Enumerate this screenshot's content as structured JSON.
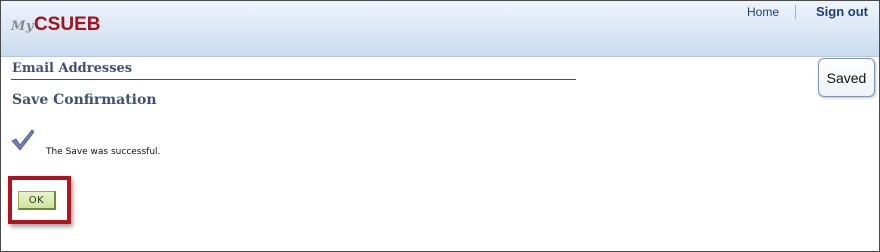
{
  "header": {
    "logo_prefix": "My",
    "logo_name": "CSUEB",
    "nav": {
      "home_label": "Home",
      "signout_label": "Sign out"
    }
  },
  "main": {
    "section_title": "Email Addresses",
    "subtitle": "Save Confirmation",
    "message": "The Save was successful.",
    "ok_label": "OK",
    "saved_badge": "Saved"
  },
  "colors": {
    "logo_red": "#a3131c",
    "heading_blue": "#3e5078",
    "highlight_red": "#b0141d",
    "button_green": "#cfe49b"
  },
  "icons": {
    "confirmation": "checkmark-icon"
  }
}
